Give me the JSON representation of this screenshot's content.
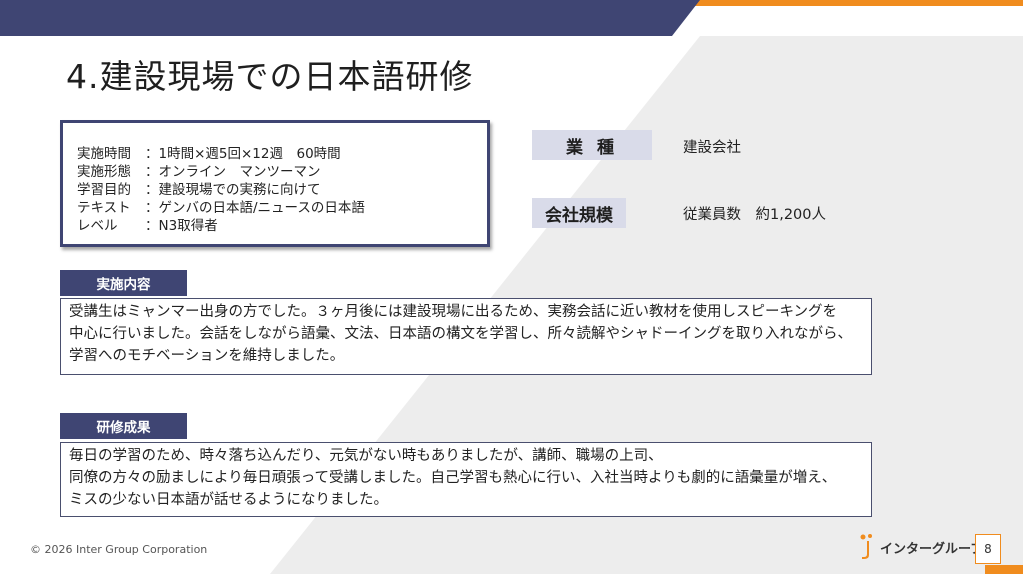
{
  "slide": {
    "title": "4.建設現場での日本語研修",
    "copyright": "© 2026 Inter Group Corporation",
    "logo_text": "インターグループ",
    "page_number": "8"
  },
  "info_box": {
    "rows": [
      {
        "key": "実施時間",
        "value": "：1時間×週5回×12週　60時間"
      },
      {
        "key": "実施形態",
        "value": "：オンライン　マンツーマン"
      },
      {
        "key": "学習目的",
        "value": "：建設現場での実務に向けて"
      },
      {
        "key": "テキスト",
        "value": "：ゲンバの日本語/ニュースの日本語"
      },
      {
        "key": "レベル",
        "value": "：N3取得者"
      }
    ]
  },
  "meta": {
    "industry_label": "業種",
    "industry_value": "建設会社",
    "size_label": "会社規模",
    "size_value": "従業員数　約1,200人"
  },
  "sections": {
    "content": {
      "header": "実施内容",
      "lines": [
        "受講生はミャンマー出身の方でした。３ヶ月後には建設現場に出るため、実務会話に近い教材を使用しスピーキングを",
        "中心に行いました。会話をしながら語彙、文法、日本語の構文を学習し、所々読解やシャドーイングを取り入れながら、",
        "学習へのモチベーションを維持しました。"
      ]
    },
    "results": {
      "header": "研修成果",
      "lines": [
        "毎日の学習のため、時々落ち込んだり、元気がない時もありましたが、講師、職場の上司、",
        "同僚の方々の励ましにより毎日頑張って受講しました。自己学習も熱心に行い、入社当時よりも劇的に語彙量が増え、",
        "ミスの少ない日本語が話せるようになりました。"
      ]
    }
  },
  "colors": {
    "navy": "#3f4573",
    "orange": "#f08c1e",
    "tag_bg": "#d9dbe9",
    "diagonal_gray": "#ededed"
  }
}
